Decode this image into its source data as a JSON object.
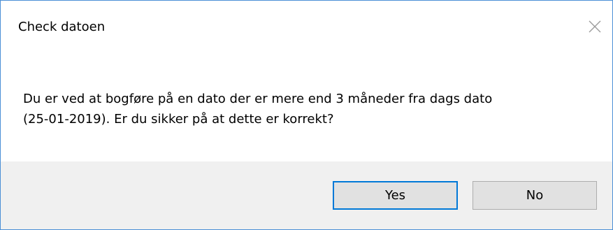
{
  "dialog": {
    "title": "Check datoen",
    "close_icon": "close-icon",
    "message_line1": "Du er ved at bogføre på en dato der er mere end 3 måneder fra dags dato",
    "message_line2": "(25-01-2019). Er du sikker på at dette er korrekt?",
    "buttons": {
      "yes_label": "Yes",
      "no_label": "No"
    },
    "colors": {
      "border": "#4b8fd6",
      "footer_bg": "#f0f0f0",
      "default_button_border": "#0078d7",
      "button_bg": "#e1e1e1"
    }
  }
}
